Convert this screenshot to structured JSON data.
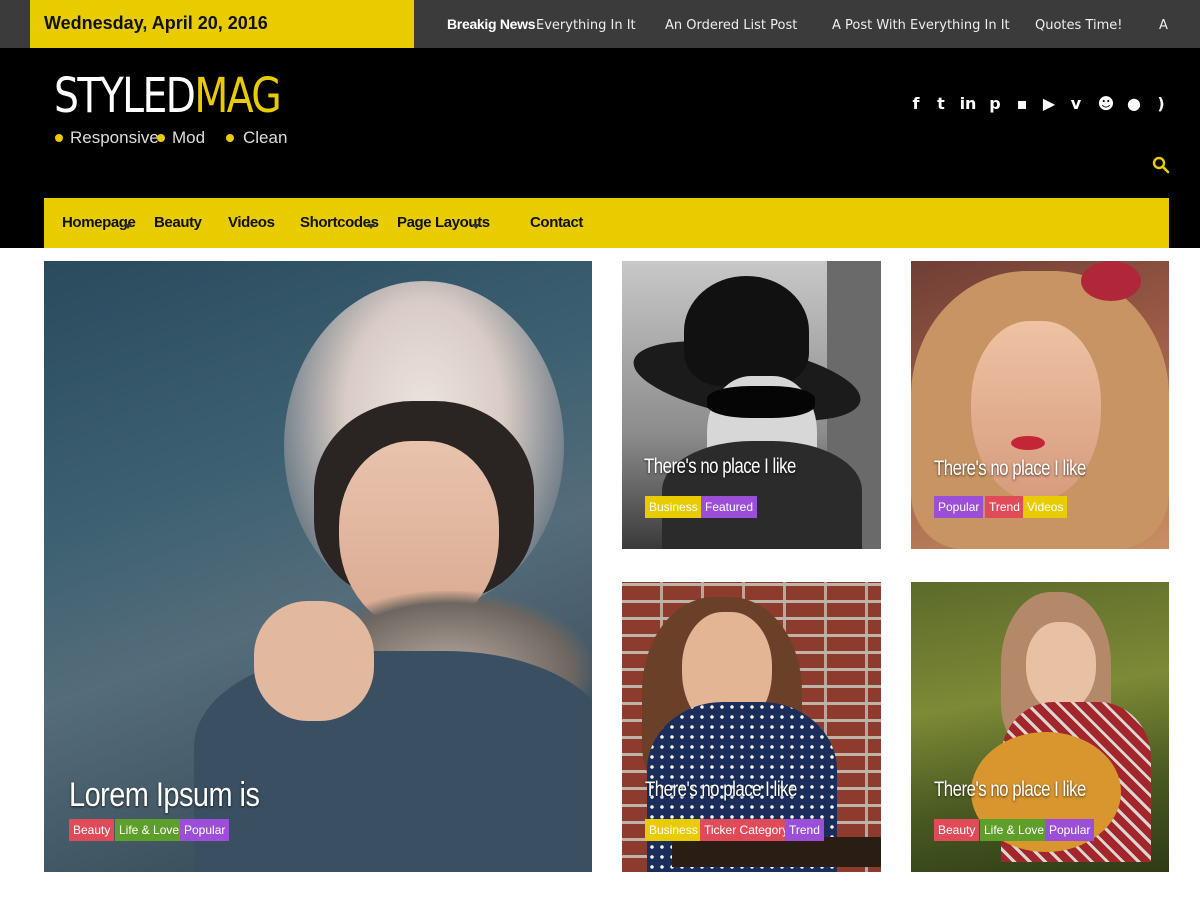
{
  "topbar": {
    "date": "Wednesday, April 20, 2016",
    "breaking_label": "Breakig News",
    "ticker": [
      "Everything In It",
      "An Ordered List Post",
      "A Post With Everything In It",
      "Quotes Time!",
      "A"
    ]
  },
  "header": {
    "logo_part1": "STYLED",
    "logo_part2": "MAG",
    "taglines": [
      "Responsive",
      "Mod",
      "Clean"
    ],
    "social_icons": [
      "facebook-icon",
      "twitter-icon",
      "linkedin-icon",
      "pinterest-icon",
      "flickr-icon",
      "youtube-icon",
      "vimeo-icon",
      "reddit-icon",
      "github-icon",
      "rss-icon"
    ],
    "social_glyphs": [
      "f",
      "t",
      "in",
      "p",
      "▪",
      "▶",
      "v",
      "☻",
      "●",
      ")"
    ]
  },
  "nav": {
    "items": [
      "Homepage",
      "Beauty",
      "Videos",
      "Shortcodes",
      "Page Layouts",
      "Contact"
    ]
  },
  "posts": [
    {
      "title": "Lorem Ipsum is",
      "tags": [
        {
          "label": "Beauty",
          "color": "red"
        },
        {
          "label": "Life & Love",
          "color": "green"
        },
        {
          "label": "Popular",
          "color": "purple"
        }
      ]
    },
    {
      "title": "There's no place I like",
      "tags": [
        {
          "label": "Business",
          "color": "yellow"
        },
        {
          "label": "Featured",
          "color": "purple"
        }
      ]
    },
    {
      "title": "There's no place I like",
      "tags": [
        {
          "label": "Popular",
          "color": "purple"
        },
        {
          "label": "Trend",
          "color": "red"
        },
        {
          "label": "Videos",
          "color": "yellow"
        }
      ]
    },
    {
      "title": "There's no place I like",
      "tags": [
        {
          "label": "Business",
          "color": "yellow"
        },
        {
          "label": "Ticker Category",
          "color": "red"
        },
        {
          "label": "Trend",
          "color": "purple"
        }
      ]
    },
    {
      "title": "There's no place I like",
      "tags": [
        {
          "label": "Beauty",
          "color": "red"
        },
        {
          "label": "Life & Love",
          "color": "green"
        },
        {
          "label": "Popular",
          "color": "purple"
        }
      ]
    }
  ],
  "colors": {
    "accent": "#e8cc00",
    "header_bg": "#000000",
    "topbar_bg": "#3b3b3b"
  }
}
